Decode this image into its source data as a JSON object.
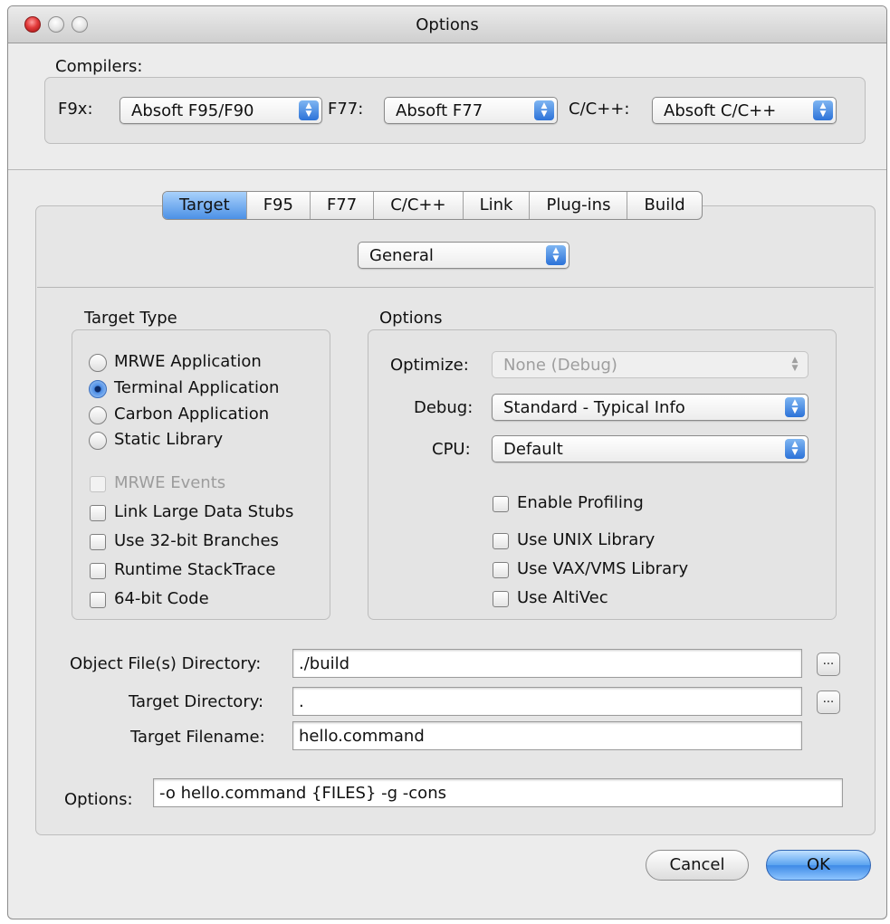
{
  "window": {
    "title": "Options"
  },
  "compilers": {
    "label": "Compilers:",
    "f9x_label": "F9x:",
    "f9x_value": "Absoft F95/F90",
    "f77_label": "F77:",
    "f77_value": "Absoft F77",
    "cc_label": "C/C++:",
    "cc_value": "Absoft C/C++"
  },
  "tabs": [
    {
      "label": "Target",
      "active": true
    },
    {
      "label": "F95"
    },
    {
      "label": "F77"
    },
    {
      "label": "C/C++"
    },
    {
      "label": "Link"
    },
    {
      "label": "Plug-ins"
    },
    {
      "label": "Build"
    }
  ],
  "section_popup": {
    "value": "General"
  },
  "target_type": {
    "label": "Target Type",
    "radios": [
      {
        "label": "MRWE Application",
        "selected": false
      },
      {
        "label": "Terminal Application",
        "selected": true
      },
      {
        "label": "Carbon Application",
        "selected": false
      },
      {
        "label": "Static Library",
        "selected": false
      }
    ],
    "checkboxes": [
      {
        "label": "MRWE Events",
        "checked": false,
        "enabled": false
      },
      {
        "label": "Link Large Data Stubs",
        "checked": false,
        "enabled": true
      },
      {
        "label": "Use 32-bit Branches",
        "checked": false,
        "enabled": true
      },
      {
        "label": "Runtime StackTrace",
        "checked": false,
        "enabled": true
      },
      {
        "label": "64-bit Code",
        "checked": false,
        "enabled": true
      }
    ]
  },
  "options_group": {
    "label": "Options",
    "optimize_label": "Optimize:",
    "optimize_value": "None (Debug)",
    "debug_label": "Debug:",
    "debug_value": "Standard - Typical Info",
    "cpu_label": "CPU:",
    "cpu_value": "Default",
    "checkboxes": [
      {
        "label": "Enable Profiling",
        "checked": false
      },
      {
        "label": "Use UNIX Library",
        "checked": false
      },
      {
        "label": "Use VAX/VMS Library",
        "checked": false
      },
      {
        "label": "Use AltiVec",
        "checked": false
      }
    ]
  },
  "paths": {
    "object_dir_label": "Object File(s) Directory:",
    "object_dir_value": "./build",
    "target_dir_label": "Target Directory:",
    "target_dir_value": ".",
    "target_filename_label": "Target Filename:",
    "target_filename_value": "hello.command",
    "browse_label": "..."
  },
  "command": {
    "label": "Options:",
    "value": "-o hello.command {FILES} -g -cons"
  },
  "buttons": {
    "cancel": "Cancel",
    "ok": "OK"
  },
  "colors": {
    "accent": "#4c91e6",
    "window_bg": "#ececec"
  }
}
